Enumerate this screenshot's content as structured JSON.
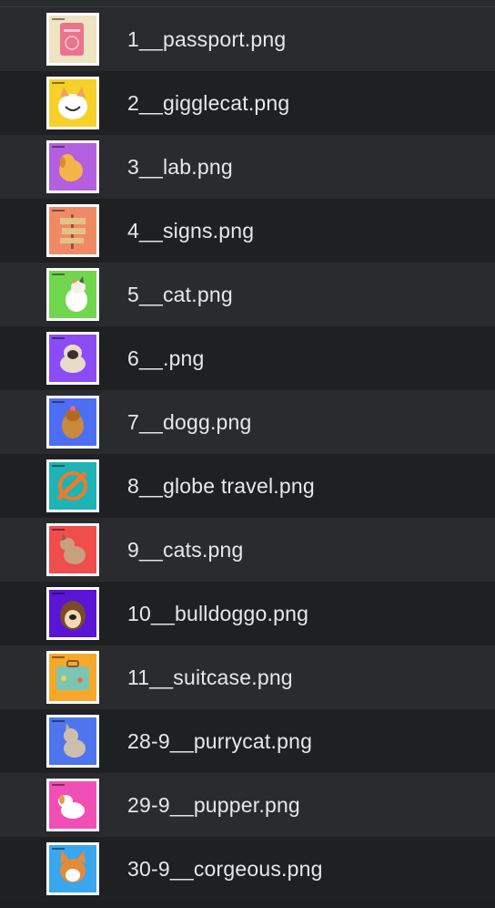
{
  "files": [
    {
      "name": "1__passport.png",
      "bg": "#efe3c2",
      "icon": "passport-thumbnail-icon"
    },
    {
      "name": "2__gigglecat.png",
      "bg": "#f6d12a",
      "icon": "giggle-cat-thumbnail-icon"
    },
    {
      "name": "3__lab.png",
      "bg": "#b45fe0",
      "icon": "lab-dog-thumbnail-icon"
    },
    {
      "name": "4__signs.png",
      "bg": "#f08a65",
      "icon": "signpost-thumbnail-icon"
    },
    {
      "name": "5__cat.png",
      "bg": "#6fd64e",
      "icon": "cat-thumbnail-icon"
    },
    {
      "name": "6__.png",
      "bg": "#8b4cf5",
      "icon": "pug-thumbnail-icon"
    },
    {
      "name": "7__dogg.png",
      "bg": "#4d6ef2",
      "icon": "yorkie-dog-thumbnail-icon"
    },
    {
      "name": "8__globe travel.png",
      "bg": "#1eb3b4",
      "icon": "globe-plane-thumbnail-icon"
    },
    {
      "name": "9__cats.png",
      "bg": "#f04d4d",
      "icon": "cats-thumbnail-icon"
    },
    {
      "name": "10__bulldoggo.png",
      "bg": "#5a15d6",
      "icon": "bulldog-thumbnail-icon"
    },
    {
      "name": "11__suitcase.png",
      "bg": "#f7a82a",
      "icon": "suitcase-thumbnail-icon"
    },
    {
      "name": "28-9__purrycat.png",
      "bg": "#4e74ee",
      "icon": "purry-cat-thumbnail-icon"
    },
    {
      "name": "29-9__pupper.png",
      "bg": "#f24fb6",
      "icon": "pupper-thumbnail-icon"
    },
    {
      "name": "30-9__corgeous.png",
      "bg": "#3aa6ee",
      "icon": "corgi-thumbnail-icon"
    }
  ]
}
